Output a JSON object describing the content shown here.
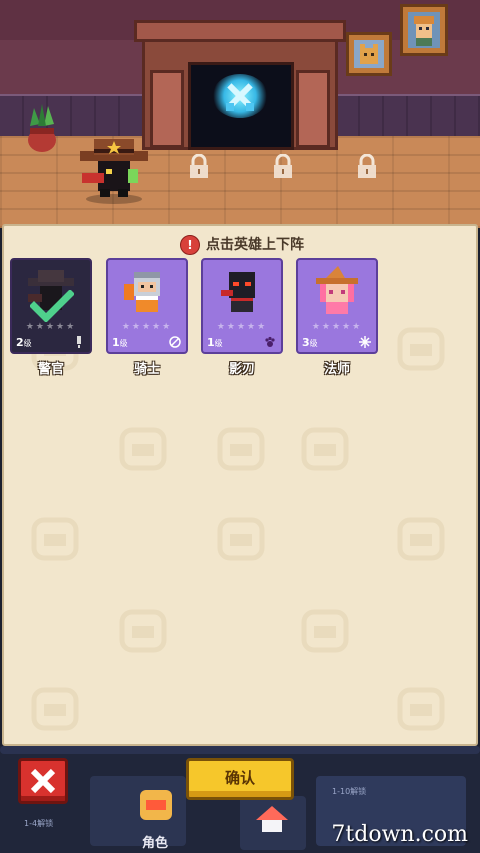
{
  "hint": {
    "text": "点击英雄上下阵",
    "alert_icon": "!"
  },
  "heroes": [
    {
      "name": "警官",
      "level": "2",
      "level_unit": "级",
      "class_icon": "bullet-icon",
      "deployed": true,
      "stars": "★★★★★"
    },
    {
      "name": "骑士",
      "level": "1",
      "level_unit": "级",
      "class_icon": "shield-icon",
      "deployed": false,
      "stars": "★★★★★"
    },
    {
      "name": "影刃",
      "level": "1",
      "level_unit": "级",
      "class_icon": "paw-icon",
      "deployed": false,
      "stars": "★★★★★"
    },
    {
      "name": "法师",
      "level": "3",
      "level_unit": "级",
      "class_icon": "spark-icon",
      "deployed": false,
      "stars": "★★★★★"
    }
  ],
  "buttons": {
    "close_icon": "✕",
    "confirm": "确认"
  },
  "bottom_nav": {
    "hero_tab": "角色",
    "small_left": "1-4解锁",
    "small_right": "1-10解锁"
  },
  "colors": {
    "card_normal": "#9a77de",
    "card_deployed": "#2b2740",
    "confirm": "#f6c72b",
    "close": "#d8322e",
    "panel": "#f2e6cc"
  },
  "watermark": "7tdown.com"
}
